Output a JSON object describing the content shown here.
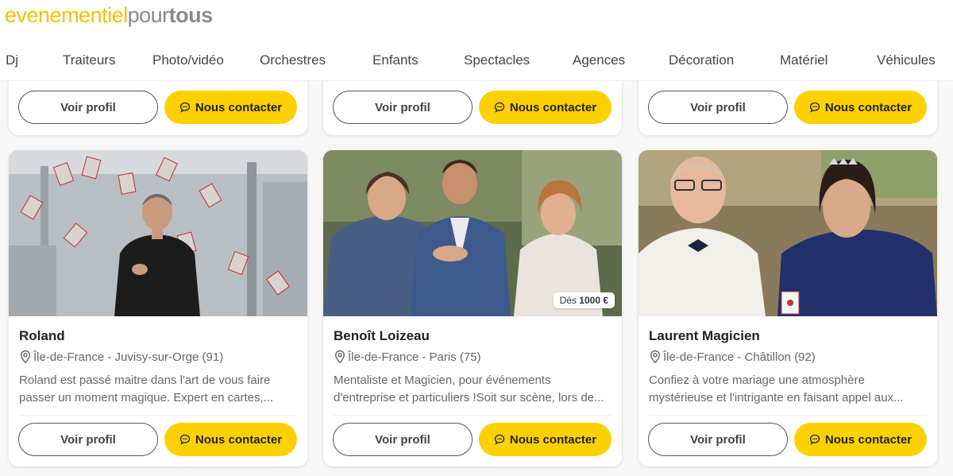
{
  "logo": {
    "part1": "evenementiel",
    "part2": "pour",
    "part3": "tous"
  },
  "nav": [
    "Dj",
    "Traiteurs",
    "Photo/vidéo",
    "Orchestres",
    "Enfants",
    "Spectacles",
    "Agences",
    "Décoration",
    "Matériel",
    "Véhicules"
  ],
  "buttons": {
    "profile": "Voir profil",
    "contact": "Nous contacter"
  },
  "cards": [
    {
      "name": "Roland",
      "location": "Île-de-France - Juvisy-sur-Orge (91)",
      "description": "Roland est passé maitre dans l'art de vous faire passer un moment magique. Expert en cartes,...",
      "price_prefix": "",
      "price": ""
    },
    {
      "name": "Benoît Loizeau",
      "location": "Île-de-France - Paris (75)",
      "description": "Mentaliste et Magicien, pour événements d'entreprise et particuliers !Soit sur scène, lors de...",
      "price_prefix": "Dès",
      "price": "1000 €"
    },
    {
      "name": "Laurent Magicien",
      "location": "Île-de-France - Châtillon (92)",
      "description": "Confiez à votre mariage une atmosphère mystérieuse et l'intrigante en faisant appel aux...",
      "price_prefix": "",
      "price": ""
    }
  ],
  "icons": {
    "location": "location-pin-icon",
    "contact": "chat-bubble-icon"
  },
  "colors": {
    "brand_yellow": "#fdd100",
    "logo_yellow": "#f2c300",
    "logo_grey": "#8a8a8a"
  }
}
